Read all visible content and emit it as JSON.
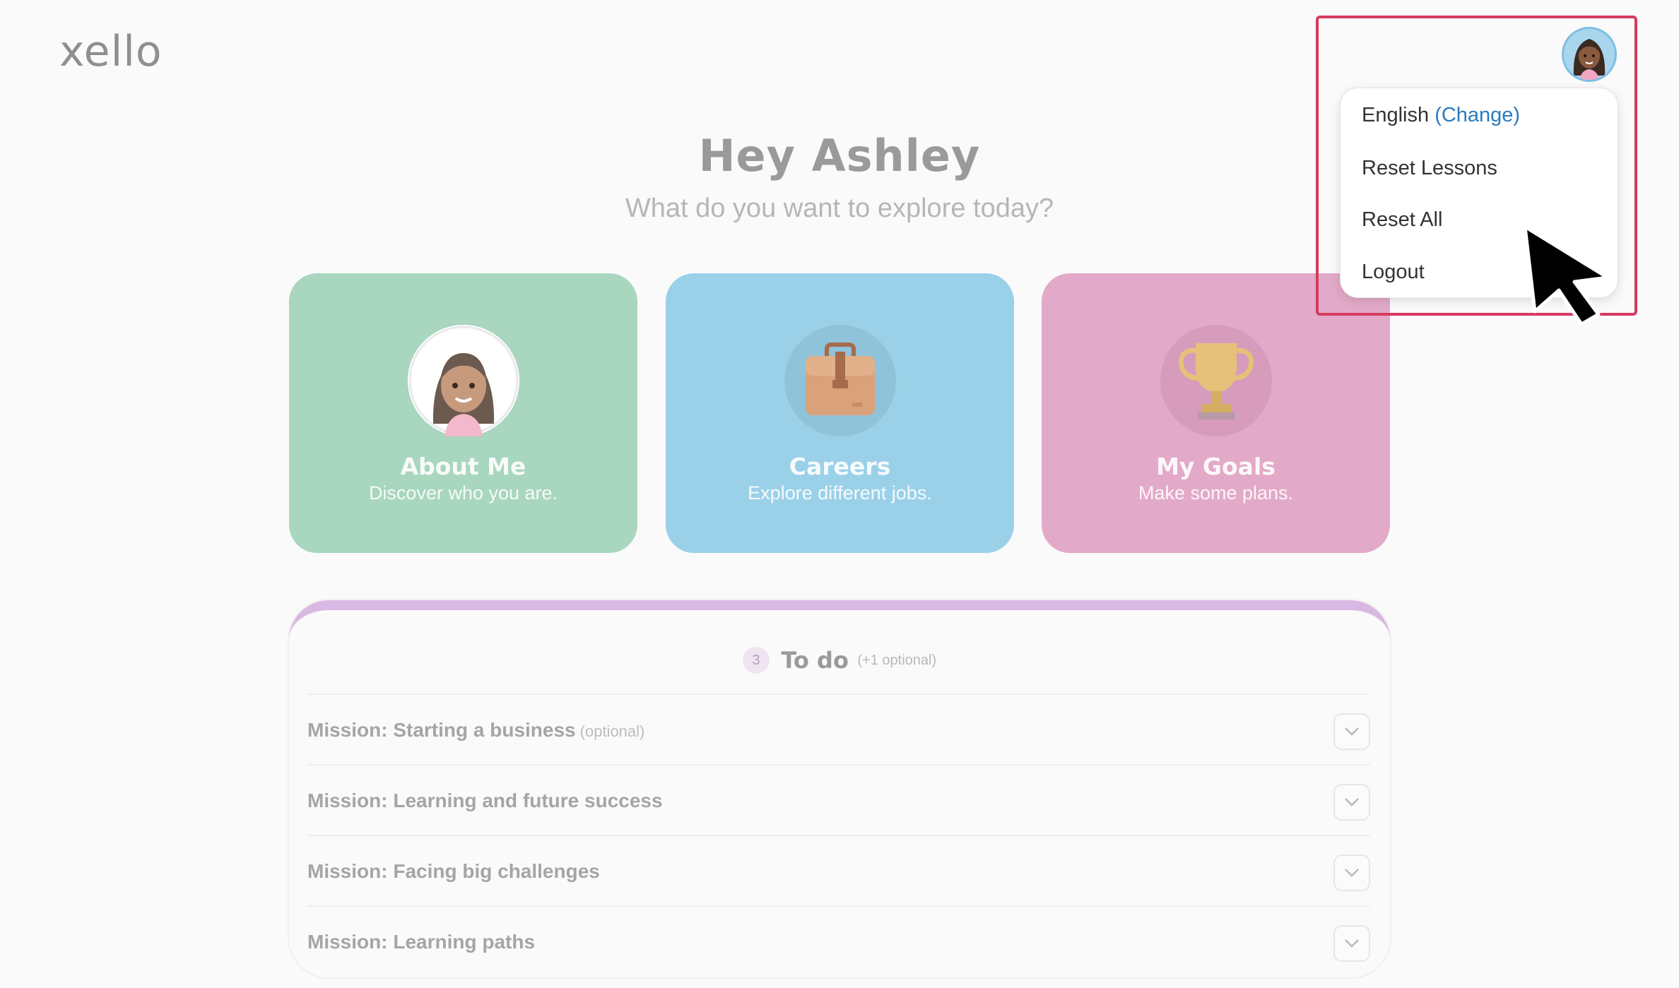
{
  "brand": {
    "logo": "xello"
  },
  "header": {
    "greeting": "Hey Ashley",
    "subtitle": "What do you want to explore today?"
  },
  "cards": [
    {
      "title": "About Me",
      "description": "Discover who you are.",
      "color": "#a8d6be",
      "icon": "girl-avatar-icon"
    },
    {
      "title": "Careers",
      "description": "Explore different jobs.",
      "color": "#9bd1e8",
      "icon": "briefcase-icon"
    },
    {
      "title": "My Goals",
      "description": "Make some plans.",
      "color": "#e3a9c8",
      "icon": "trophy-icon"
    }
  ],
  "todo": {
    "count": "3",
    "label": "To do",
    "optional_note": "(+1 optional)",
    "missions": [
      {
        "title": "Mission: Starting a business",
        "optional": "(optional)"
      },
      {
        "title": "Mission: Learning and future success",
        "optional": ""
      },
      {
        "title": "Mission: Facing big challenges",
        "optional": ""
      },
      {
        "title": "Mission: Learning paths",
        "optional": ""
      }
    ]
  },
  "user_menu": {
    "language": "English",
    "change": "(Change)",
    "reset_lessons": "Reset Lessons",
    "reset_all": "Reset All",
    "logout": "Logout"
  },
  "colors": {
    "highlight": "#d6395f",
    "link": "#2a7bbf",
    "todo_accent": "#d8b9e3"
  }
}
